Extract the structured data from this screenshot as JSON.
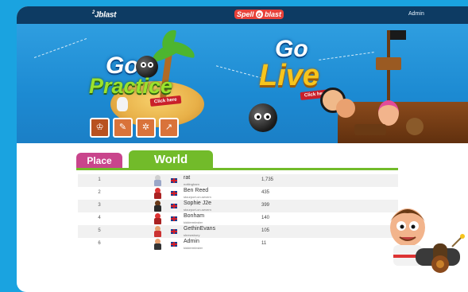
{
  "header": {
    "logo_text": "Jblast",
    "logo_sup": "2",
    "center_logo": "Spell",
    "center_logo_mid": "o",
    "center_logo_suffix": "blast",
    "user": "Admin"
  },
  "banner": {
    "practice": {
      "go": "Go",
      "label": "Practice",
      "cta": "Click here"
    },
    "live": {
      "go": "Go",
      "label": "Live",
      "cta": "Click here"
    },
    "mode_icons": [
      "crown-icon",
      "quill-icon",
      "ship-wheel-icon",
      "chart-icon"
    ]
  },
  "tabs": [
    {
      "label": "Place",
      "active": false
    },
    {
      "label": "World",
      "active": true
    }
  ],
  "leaderboard": [
    {
      "rank": "1",
      "name": "rat",
      "town": "nottingham",
      "score": "1,735",
      "avatar": "rat-avatar"
    },
    {
      "rank": "2",
      "name": "Ben Reed",
      "town": "stourport-on-severn",
      "score": "435",
      "avatar": "red-pirate-avatar"
    },
    {
      "rank": "3",
      "name": "Sophie J2e",
      "town": "stourport-on-severn",
      "score": "399",
      "avatar": "dark-pirate-avatar"
    },
    {
      "rank": "4",
      "name": "Bonham",
      "town": "kidderminster",
      "score": "140",
      "avatar": "red-pirate-avatar"
    },
    {
      "rank": "5",
      "name": "GethinEvans",
      "town": "shrewsbury",
      "score": "105",
      "avatar": "pirate-avatar"
    },
    {
      "rank": "6",
      "name": "Admin",
      "town": "kidderminster",
      "score": "11",
      "avatar": "cannon-pirate-avatar"
    }
  ],
  "colors": {
    "page_bg": "#1aa3e0",
    "topbar": "#0d3b63",
    "place_tab": "#c9458c",
    "world_tab": "#72bb2a"
  }
}
